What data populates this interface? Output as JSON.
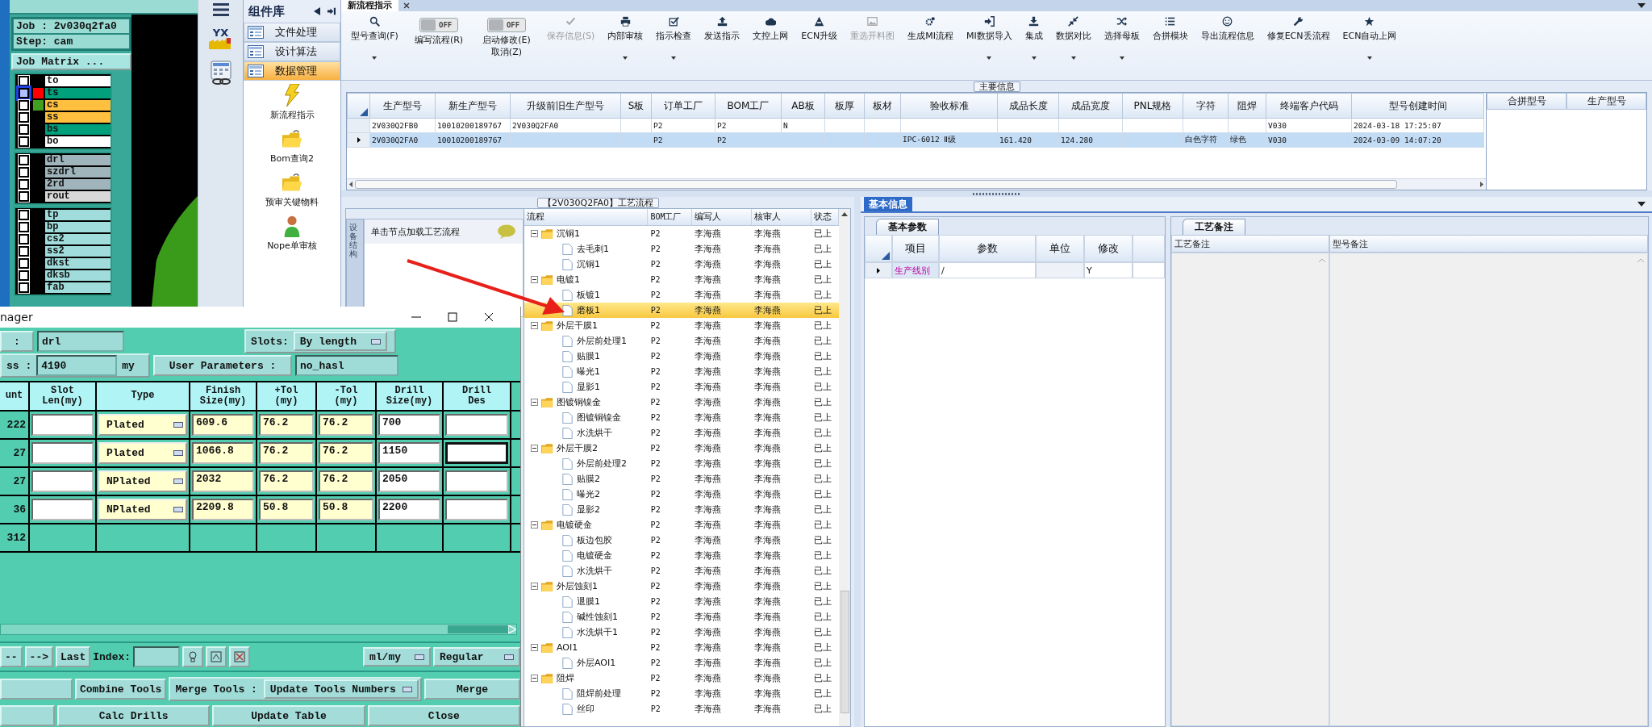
{
  "cam": {
    "job_line": "Job : 2v030q2fa0",
    "step_line": "Step: cam",
    "matrix_button": "Job Matrix ...",
    "layer_groups": [
      {
        "layers": [
          {
            "name": "to",
            "color": "#ffffff",
            "selected": false
          },
          {
            "name": "ts",
            "color": "#00a07c",
            "swatch": {
              "color": "#ff0000"
            },
            "selected": true
          },
          {
            "name": "cs",
            "color": "#ffc040",
            "swatch": {
              "color": "#40a020"
            },
            "selected": false
          },
          {
            "name": "ss",
            "color": "#ffc040",
            "selected": false
          },
          {
            "name": "bs",
            "color": "#00a07c",
            "selected": false
          },
          {
            "name": "bo",
            "color": "#ffffff",
            "selected": false
          }
        ]
      },
      {
        "layers": [
          {
            "name": "drl",
            "color": "#a0b4bc",
            "selected": false
          },
          {
            "name": "szdrl",
            "color": "#a0b4bc",
            "selected": false
          },
          {
            "name": "2rd",
            "color": "#a0b4bc",
            "selected": false
          },
          {
            "name": "rout",
            "color": "#d8d8d8",
            "selected": false
          }
        ]
      },
      {
        "layers": [
          {
            "name": "tp",
            "color": "#a0dcdc",
            "selected": false
          },
          {
            "name": "bp",
            "color": "#a0dcdc",
            "selected": false
          },
          {
            "name": "cs2",
            "color": "#a0dcdc",
            "selected": false
          },
          {
            "name": "ss2",
            "color": "#a0dcdc",
            "selected": false
          },
          {
            "name": "dkst",
            "color": "#a0dcdc",
            "selected": false
          },
          {
            "name": "dksb",
            "color": "#a0dcdc",
            "selected": false
          },
          {
            "name": "fab",
            "color": "#a0dcdc",
            "selected": false
          }
        ]
      }
    ]
  },
  "side_logo": {
    "text": "YX"
  },
  "library": {
    "title": "组件库",
    "categories": [
      {
        "label": "文件处理",
        "selected": false
      },
      {
        "label": "设计算法",
        "selected": false
      },
      {
        "label": "数据管理",
        "selected": true
      }
    ],
    "items": [
      {
        "label": "新流程指示",
        "kind": "lightning"
      },
      {
        "label": "Bom查询2",
        "kind": "folder"
      },
      {
        "label": "预审关键物料",
        "kind": "folder"
      },
      {
        "label": "Nope单审核",
        "kind": "person"
      }
    ]
  },
  "main_tab": {
    "label": "新流程指示"
  },
  "toolbar": [
    {
      "kind": "button",
      "label": "型号查询(F)",
      "disabled": false,
      "dropdown": true
    },
    {
      "kind": "toggle",
      "switch": "OFF",
      "on": false,
      "label": "编写流程(R)"
    },
    {
      "kind": "toggle",
      "switch": "OFF",
      "on": false,
      "label": "启动修改(E)",
      "label2": "取消(Z)"
    },
    {
      "kind": "button",
      "label": "保存信息(S)",
      "disabled": true,
      "dropdown": false
    },
    {
      "kind": "button",
      "label": "内部审核",
      "disabled": false,
      "dropdown": true
    },
    {
      "kind": "button",
      "label": "指示检查",
      "disabled": false,
      "dropdown": true
    },
    {
      "kind": "button",
      "label": "发送指示",
      "disabled": false,
      "dropdown": false
    },
    {
      "kind": "button",
      "label": "文控上网",
      "disabled": false,
      "dropdown": false
    },
    {
      "kind": "button",
      "label": "ECN升级",
      "disabled": false,
      "dropdown": false
    },
    {
      "kind": "button",
      "label": "重选开料图",
      "disabled": true,
      "dropdown": false
    },
    {
      "kind": "button",
      "label": "生成MI流程",
      "disabled": false,
      "dropdown": false
    },
    {
      "kind": "button",
      "label": "MI数据导入",
      "disabled": false,
      "dropdown": true
    },
    {
      "kind": "button",
      "label": "集成",
      "disabled": false,
      "dropdown": true
    },
    {
      "kind": "button",
      "label": "数据对比",
      "disabled": false,
      "dropdown": true
    },
    {
      "kind": "button",
      "label": "选择母板",
      "disabled": false,
      "dropdown": true
    },
    {
      "kind": "button",
      "label": "合拼模块",
      "disabled": false,
      "dropdown": false
    },
    {
      "kind": "button",
      "label": "导出流程信息",
      "disabled": false,
      "dropdown": false
    },
    {
      "kind": "button",
      "label": "修复ECN丢流程",
      "disabled": false,
      "dropdown": false
    },
    {
      "kind": "button",
      "label": "ECN自动上网",
      "disabled": false,
      "dropdown": true
    }
  ],
  "main_info": {
    "legend": "主要信息",
    "columns": [
      "生产型号",
      "新生产型号",
      "升级前旧生产型号",
      "S板",
      "订单工厂",
      "BOM工厂",
      "AB板",
      "板厚",
      "板材",
      "验收标准",
      "成品长度",
      "成品宽度",
      "PNL规格",
      "字符",
      "阻焊",
      "终端客户代码",
      "型号创建时间"
    ],
    "rows": [
      {
        "selected": false,
        "cells": [
          "2V030Q2FB0",
          "10010200189767",
          "2V030Q2FA0",
          null,
          "P2",
          "P2",
          "N",
          null,
          null,
          null,
          null,
          null,
          null,
          null,
          null,
          "V030",
          "2024-03-18 17:25:07"
        ]
      },
      {
        "selected": true,
        "cells": [
          "2V030Q2FA0",
          "10010200189767",
          null,
          null,
          "P2",
          "P2",
          null,
          null,
          null,
          "IPC-6012 Ⅱ级",
          "161.420",
          "124.280",
          null,
          "白色字符",
          "绿色",
          "V030",
          "2024-03-09 14:07:20"
        ]
      }
    ],
    "merge_columns": [
      "合拼型号",
      "生产型号"
    ]
  },
  "process": {
    "legend": "【2V030Q2FA0】工艺流程",
    "side_tab": "设备结构",
    "hint": "单击节点加载工艺流程",
    "columns": [
      "流程",
      "BOM工厂",
      "编写人",
      "核审人",
      "状态"
    ],
    "tree": [
      {
        "name": "沉铜1",
        "bom": "P2",
        "writer": "李海燕",
        "reviewer": "李海燕",
        "status": "已上",
        "expanded": true,
        "selected": false,
        "children": [
          {
            "name": "去毛刺1",
            "bom": "P2",
            "writer": "李海燕",
            "reviewer": "李海燕",
            "status": "已上",
            "selected": false
          },
          {
            "name": "沉铜1",
            "bom": "P2",
            "writer": "李海燕",
            "reviewer": "李海燕",
            "status": "已上",
            "selected": false
          }
        ]
      },
      {
        "name": "电镀1",
        "bom": "P2",
        "writer": "李海燕",
        "reviewer": "李海燕",
        "status": "已上",
        "expanded": true,
        "selected": false,
        "children": [
          {
            "name": "板镀1",
            "bom": "P2",
            "writer": "李海燕",
            "reviewer": "李海燕",
            "status": "已上",
            "selected": false
          },
          {
            "name": "磨板1",
            "bom": "P2",
            "writer": "李海燕",
            "reviewer": "李海燕",
            "status": "已上",
            "selected": true
          }
        ]
      },
      {
        "name": "外层干膜1",
        "bom": "P2",
        "writer": "李海燕",
        "reviewer": "李海燕",
        "status": "已上",
        "expanded": true,
        "selected": false,
        "children": [
          {
            "name": "外层前处理1",
            "bom": "P2",
            "writer": "李海燕",
            "reviewer": "李海燕",
            "status": "已上",
            "selected": false
          },
          {
            "name": "贴膜1",
            "bom": "P2",
            "writer": "李海燕",
            "reviewer": "李海燕",
            "status": "已上",
            "selected": false
          },
          {
            "name": "曝光1",
            "bom": "P2",
            "writer": "李海燕",
            "reviewer": "李海燕",
            "status": "已上",
            "selected": false
          },
          {
            "name": "显影1",
            "bom": "P2",
            "writer": "李海燕",
            "reviewer": "李海燕",
            "status": "已上",
            "selected": false
          }
        ]
      },
      {
        "name": "图镀铜镍金",
        "bom": "P2",
        "writer": "李海燕",
        "reviewer": "李海燕",
        "status": "已上",
        "expanded": true,
        "selected": false,
        "children": [
          {
            "name": "图镀铜镍金",
            "bom": "P2",
            "writer": "李海燕",
            "reviewer": "李海燕",
            "status": "已上",
            "selected": false
          },
          {
            "name": "水洗烘干",
            "bom": "P2",
            "writer": "李海燕",
            "reviewer": "李海燕",
            "status": "已上",
            "selected": false
          }
        ]
      },
      {
        "name": "外层干膜2",
        "bom": "P2",
        "writer": "李海燕",
        "reviewer": "李海燕",
        "status": "已上",
        "expanded": true,
        "selected": false,
        "children": [
          {
            "name": "外层前处理2",
            "bom": "P2",
            "writer": "李海燕",
            "reviewer": "李海燕",
            "status": "已上",
            "selected": false
          },
          {
            "name": "贴膜2",
            "bom": "P2",
            "writer": "李海燕",
            "reviewer": "李海燕",
            "status": "已上",
            "selected": false
          },
          {
            "name": "曝光2",
            "bom": "P2",
            "writer": "李海燕",
            "reviewer": "李海燕",
            "status": "已上",
            "selected": false
          },
          {
            "name": "显影2",
            "bom": "P2",
            "writer": "李海燕",
            "reviewer": "李海燕",
            "status": "已上",
            "selected": false
          }
        ]
      },
      {
        "name": "电镀硬金",
        "bom": "P2",
        "writer": "李海燕",
        "reviewer": "李海燕",
        "status": "已上",
        "expanded": true,
        "selected": false,
        "children": [
          {
            "name": "板边包胶",
            "bom": "P2",
            "writer": "李海燕",
            "reviewer": "李海燕",
            "status": "已上",
            "selected": false
          },
          {
            "name": "电镀硬金",
            "bom": "P2",
            "writer": "李海燕",
            "reviewer": "李海燕",
            "status": "已上",
            "selected": false
          },
          {
            "name": "水洗烘干",
            "bom": "P2",
            "writer": "李海燕",
            "reviewer": "李海燕",
            "status": "已上",
            "selected": false
          }
        ]
      },
      {
        "name": "外层蚀刻1",
        "bom": "P2",
        "writer": "李海燕",
        "reviewer": "李海燕",
        "status": "已上",
        "expanded": true,
        "selected": false,
        "children": [
          {
            "name": "退膜1",
            "bom": "P2",
            "writer": "李海燕",
            "reviewer": "李海燕",
            "status": "已上",
            "selected": false
          },
          {
            "name": "碱性蚀刻1",
            "bom": "P2",
            "writer": "李海燕",
            "reviewer": "李海燕",
            "status": "已上",
            "selected": false
          },
          {
            "name": "水洗烘干1",
            "bom": "P2",
            "writer": "李海燕",
            "reviewer": "李海燕",
            "status": "已上",
            "selected": false
          }
        ]
      },
      {
        "name": "AOI1",
        "bom": "P2",
        "writer": "李海燕",
        "reviewer": "李海燕",
        "status": "已上",
        "expanded": true,
        "selected": false,
        "children": [
          {
            "name": "外层AOI1",
            "bom": "P2",
            "writer": "李海燕",
            "reviewer": "李海燕",
            "status": "已上",
            "selected": false
          }
        ]
      },
      {
        "name": "阻焊",
        "bom": "P2",
        "writer": "李海燕",
        "reviewer": "李海燕",
        "status": "已上",
        "expanded": true,
        "selected": false,
        "children": [
          {
            "name": "阻焊前处理",
            "bom": "P2",
            "writer": "李海燕",
            "reviewer": "李海燕",
            "status": "已上",
            "selected": false
          },
          {
            "name": "丝印",
            "bom": "P2",
            "writer": "李海燕",
            "reviewer": "李海燕",
            "status": "已上",
            "selected": false
          }
        ]
      }
    ]
  },
  "basic_info": {
    "tab": "基本信息",
    "params_tab": "基本参数",
    "columns": [
      "项目",
      "参数",
      "单位",
      "修改"
    ],
    "rows": [
      {
        "selected": true,
        "cells": [
          "生产线别",
          "/",
          null,
          "Y"
        ]
      }
    ],
    "notes_tab": "工艺备注",
    "notes_columns": [
      "工艺备注",
      "型号备注"
    ]
  },
  "tool_manager": {
    "title": "nager",
    "name_label": ":",
    "name_value": "drl",
    "slots_label": "Slots:",
    "slots_value": "By length",
    "thickness_label": "ss :",
    "thickness_value": "4190",
    "thickness_unit": "my",
    "user_params_button": "User Parameters :",
    "user_params_value": "no_hasl",
    "columns": [
      [
        "unt"
      ],
      [
        "Slot",
        "Len(my)"
      ],
      [
        "Type"
      ],
      [
        "Finish",
        "Size(my)"
      ],
      [
        "+Tol",
        "(my)"
      ],
      [
        "-Tol",
        "(my)"
      ],
      [
        "Drill",
        "Size(my)"
      ],
      [
        "Drill",
        "Des"
      ]
    ],
    "rows": [
      {
        "count": "222",
        "type": "Plated",
        "finish": "609.6",
        "plus_tol": "76.2",
        "minus_tol": "76.2",
        "drill": "700",
        "des_focused": false
      },
      {
        "count": "27",
        "type": "Plated",
        "finish": "1066.8",
        "plus_tol": "76.2",
        "minus_tol": "76.2",
        "drill": "1150",
        "des_focused": true
      },
      {
        "count": "27",
        "type": "NPlated",
        "finish": "2032",
        "plus_tol": "76.2",
        "minus_tol": "76.2",
        "drill": "2050",
        "des_focused": false
      },
      {
        "count": "36",
        "type": "NPlated",
        "finish": "2209.8",
        "plus_tol": "50.8",
        "minus_tol": "50.8",
        "drill": "2200",
        "des_focused": false
      }
    ],
    "total": "312",
    "nav_buttons": [
      "--",
      "-->",
      "Last"
    ],
    "index_label": "Index:",
    "units": "ml/my",
    "mode": "Regular",
    "combine_button": "Combine Tools",
    "merge_label": "Merge Tools :",
    "merge_mode": "Update Tools Numbers",
    "merge_button": "Merge",
    "bottom_buttons": [
      "Calc Drills",
      "Update Table",
      "Close"
    ]
  }
}
